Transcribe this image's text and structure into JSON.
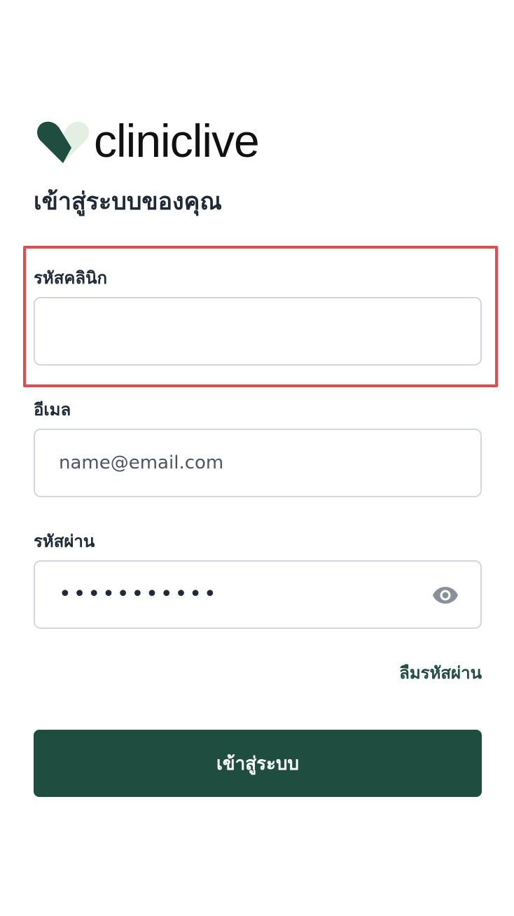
{
  "brand": {
    "name_part1": "clinic",
    "name_part2": "live",
    "colors": {
      "primary_dark": "#1f4d3f",
      "leaf_light": "#e3efe2",
      "leaf_dark": "#1f4d3f"
    },
    "logo_icon": "heart-leaf-icon"
  },
  "page": {
    "title": "เข้าสู่ระบบของคุณ"
  },
  "form": {
    "clinic_code": {
      "label": "รหัสคลินิก",
      "value": "",
      "placeholder": ""
    },
    "email": {
      "label": "อีเมล",
      "value": "",
      "placeholder": "name@email.com"
    },
    "password": {
      "label": "รหัสผ่าน",
      "masked_value": "•••••••••••",
      "toggle_icon": "eye-icon"
    },
    "forgot_password": "ลืมรหัสผ่าน",
    "submit_label": "เข้าสู่ระบบ"
  },
  "highlight": {
    "color": "#e24c50",
    "target": "clinic_code"
  }
}
